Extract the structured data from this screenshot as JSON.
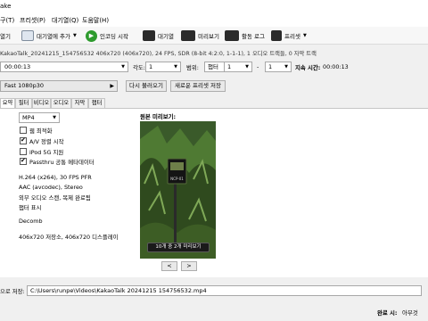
{
  "window": {
    "title_fragment": "ake"
  },
  "menu": [
    {
      "label": "구(T)"
    },
    {
      "label": "프리셋(P)"
    },
    {
      "label": "대기열(Q)"
    },
    {
      "label": "도움말(H)"
    }
  ],
  "toolbar": {
    "open_label": "열기",
    "add_queue_label": "대기열에 추가",
    "start_label": "인코딩 시작",
    "queue_label": "대기열",
    "preview_label": "미리보기",
    "activity_label": "활동 로그",
    "presets_label": "프리셋"
  },
  "source": {
    "info": "KakaoTalk_20241215_154756532  406x720 (406x720), 24 FPS, SDR (8-bit 4:2:0, 1-1-1), 1 오디오 트랙들, 0 자막 트랙"
  },
  "range": {
    "duration_value": "00:00:13",
    "angle_label": "각도:",
    "angle_value": "1",
    "range_label": "범위:",
    "range_type": "챕터",
    "start_value": "1",
    "dash": "-",
    "end_value": "1",
    "duration_label": "지속 시간:",
    "duration_total": "00:00:13"
  },
  "preset": {
    "selected": "Fast 1080p30",
    "reload_label": "다시 불러오기",
    "save_new_label": "새로운 프리셋 저장"
  },
  "tabs": [
    {
      "label": "요약"
    },
    {
      "label": "필터"
    },
    {
      "label": "비디오"
    },
    {
      "label": "오디오"
    },
    {
      "label": "자막"
    },
    {
      "label": "챕터"
    }
  ],
  "summary": {
    "format_value": "MP4",
    "options": [
      {
        "label": "웹 최적화",
        "checked": false
      },
      {
        "label": "A/V 정렬 시작",
        "checked": true
      },
      {
        "label": "iPod 5G 지원",
        "checked": false
      },
      {
        "label": "Passthru 공통 메타데이터",
        "checked": true
      }
    ],
    "info_lines": [
      "H.264 (x264), 30 FPS PFR",
      "AAC (avcodec), Stereo",
      "외부 오디오 스캔, 목제 완료됨",
      "챕터 표시"
    ],
    "filter_line": "Decomb",
    "size_line": "406x720 저장소, 406x720 디스플레이",
    "preview_title": "원본 미리보기:",
    "preview_caption": "10개 중 2개 미리보기",
    "sign_text": "NCP-01",
    "prev_label": "<",
    "next_label": ">"
  },
  "save": {
    "label": "으로 저장:",
    "path": "C:\\Users\\runpe\\Videos\\KakaoTalk 20241215 154756532.mp4"
  },
  "status": {
    "done_label": "완료 시:",
    "done_value": "아무것"
  },
  "colors": {
    "accent_green": "#2e9b2e",
    "icon_blue": "#2a64b8",
    "check_border": "#555555"
  }
}
